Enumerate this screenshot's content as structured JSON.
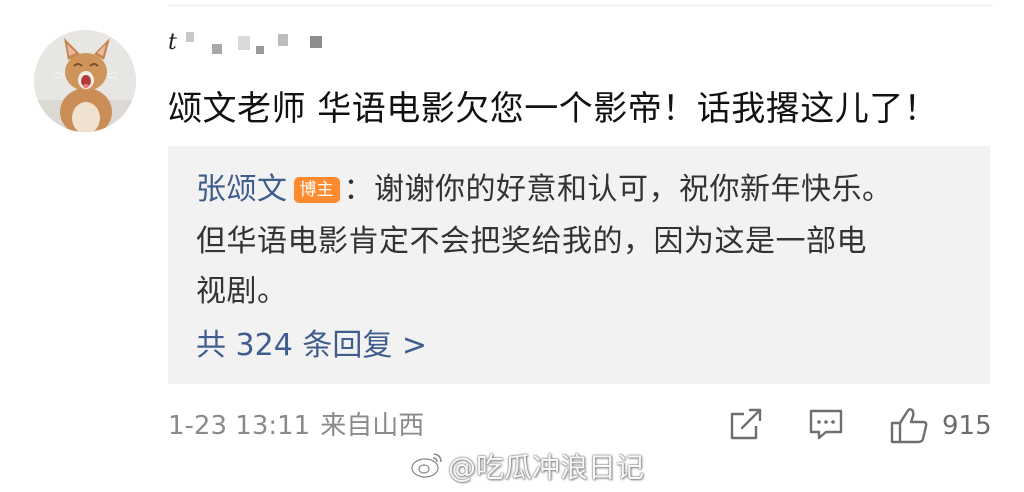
{
  "comment": {
    "username_visible": "t",
    "text": "颂文老师 华语电影欠您一个影帝！话我撂这儿了！",
    "time": "1-23 13:11",
    "source": "来自山西",
    "like_count": "915"
  },
  "reply": {
    "author": "张颂文",
    "badge": "博主",
    "line1": "：谢谢你的好意和认可，祝你新年快乐。",
    "line2": "但华语电影肯定不会把奖给我的，因为这是一部电",
    "line3": "视剧。",
    "more_label": "共 324 条回复 >"
  },
  "watermark": {
    "text": "@吃瓜冲浪日记"
  },
  "icons": {
    "share": "share-icon",
    "comment": "comment-icon",
    "like": "thumbs-up-icon",
    "weibo": "weibo-logo"
  },
  "colors": {
    "link_blue": "#3f5e8d",
    "badge_orange": "#ff8a2f",
    "reply_bg": "#f2f2f2",
    "meta_gray": "#8a8a8a"
  }
}
